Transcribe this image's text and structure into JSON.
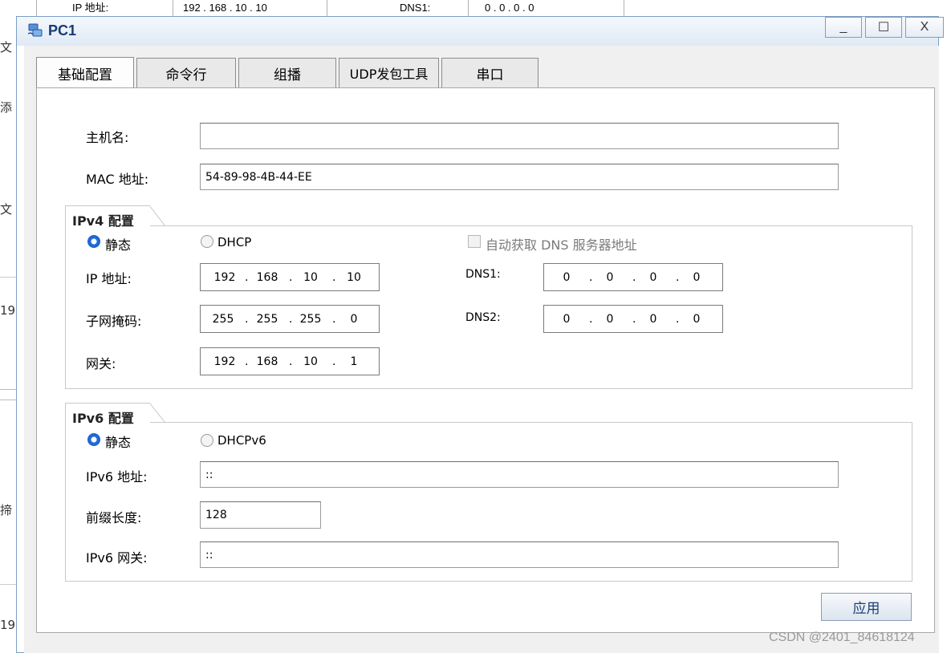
{
  "background": {
    "row": {
      "ip_label": "IP 地址:",
      "ip_value": "192 . 168 . 10 . 10",
      "dns_label": "DNS1:",
      "dns_value": "0 . 0 . 0 . 0"
    },
    "left_fragments": [
      "文",
      "添",
      "文",
      "19",
      "揥",
      "19"
    ]
  },
  "window": {
    "title": "PC1",
    "minimize": "_",
    "maximize": "☐",
    "close": "X",
    "icon": "pc-network-icon"
  },
  "tabs": [
    {
      "label": "基础配置",
      "active": true
    },
    {
      "label": "命令行",
      "active": false
    },
    {
      "label": "组播",
      "active": false
    },
    {
      "label": "UDP发包工具",
      "active": false
    },
    {
      "label": "串口",
      "active": false
    }
  ],
  "basic": {
    "hostname_label": "主机名:",
    "hostname_value": "",
    "mac_label": "MAC 地址:",
    "mac_value": "54-89-98-4B-44-EE"
  },
  "ipv4": {
    "title": "IPv4 配置",
    "static_label": "静态",
    "dhcp_label": "DHCP",
    "auto_dns_label": "自动获取 DNS 服务器地址",
    "ip_label": "IP 地址:",
    "ip": [
      "192",
      "168",
      "10",
      "10"
    ],
    "mask_label": "子网掩码:",
    "mask": [
      "255",
      "255",
      "255",
      "0"
    ],
    "gateway_label": "网关:",
    "gateway": [
      "192",
      "168",
      "10",
      "1"
    ],
    "dns1_label": "DNS1:",
    "dns1": [
      "0",
      "0",
      "0",
      "0"
    ],
    "dns2_label": "DNS2:",
    "dns2": [
      "0",
      "0",
      "0",
      "0"
    ],
    "mode": "static"
  },
  "ipv6": {
    "title": "IPv6 配置",
    "static_label": "静态",
    "dhcp_label": "DHCPv6",
    "address_label": "IPv6 地址:",
    "address_value": "::",
    "prefix_label": "前缀长度:",
    "prefix_value": "128",
    "gateway_label": "IPv6 网关:",
    "gateway_value": "::",
    "mode": "static"
  },
  "apply_button": "应用",
  "watermark": "CSDN @2401_84618124",
  "colors": {
    "accent": "#1e6ad4",
    "title_text": "#1a3a73",
    "window_border": "#7a9ec6"
  }
}
